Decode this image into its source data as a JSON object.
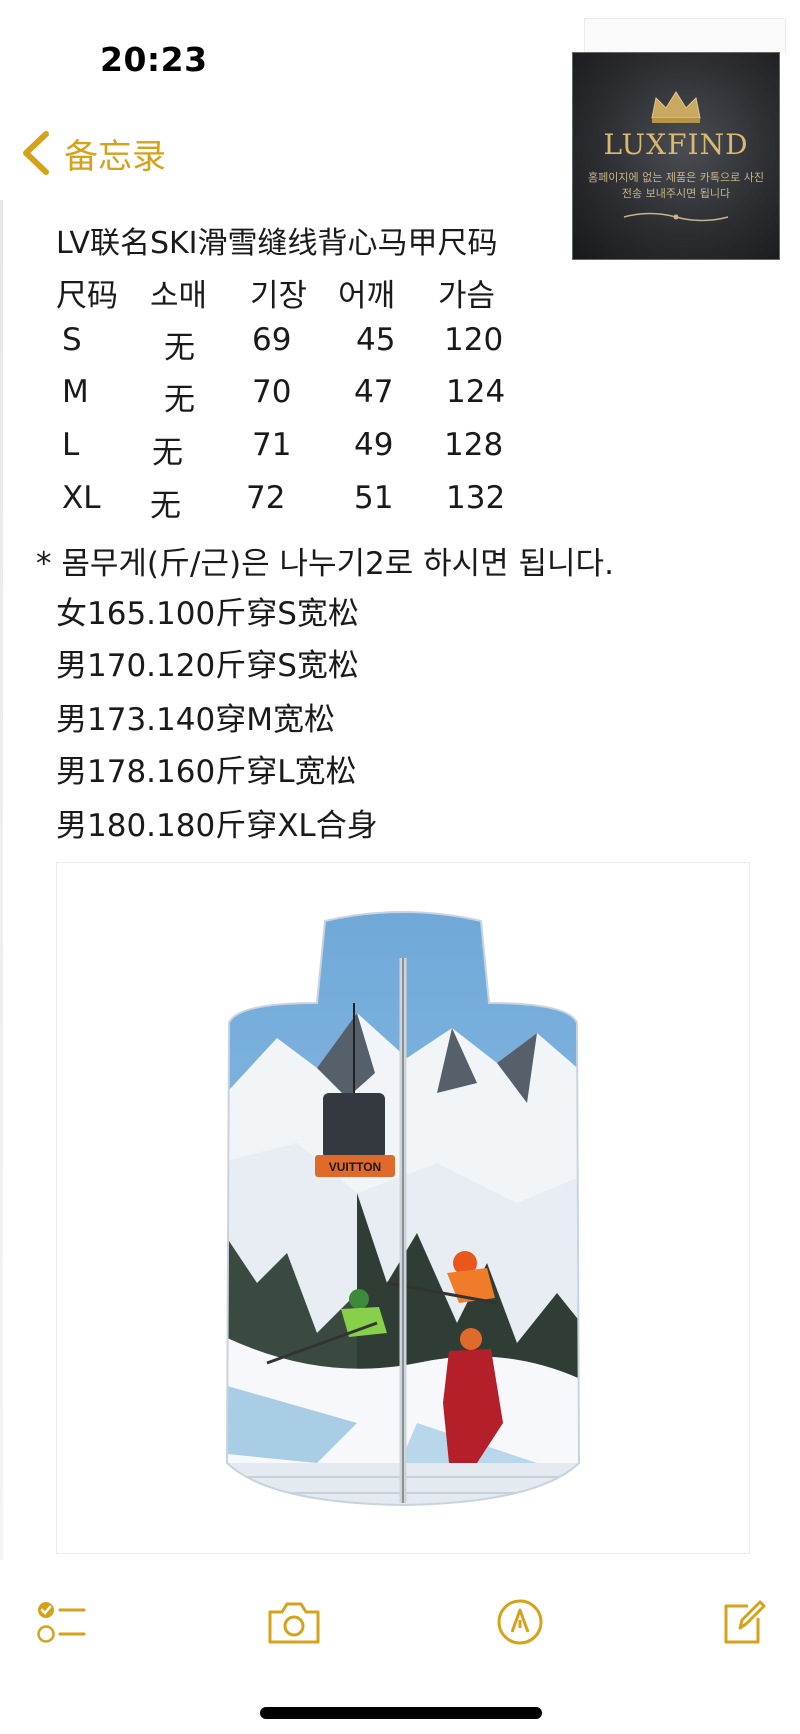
{
  "status": {
    "time": "20:23"
  },
  "nav": {
    "back_label": "备忘录"
  },
  "banner": {
    "brand": "LUXFIND",
    "tagline": "홈페이지에 없는 제품은 카톡으로 사진 전송 보내주시면 됩니다"
  },
  "note": {
    "title": "LV联名SKI滑雪缝线背心马甲尺码",
    "size_table": {
      "headers": [
        "尺码",
        "소매",
        "기장",
        "어깨",
        "가슴"
      ],
      "rows": [
        [
          "S",
          "无",
          "69",
          "45",
          "120"
        ],
        [
          "M",
          "无",
          "70",
          "47",
          "124"
        ],
        [
          "L",
          "无",
          "71",
          "49",
          "128"
        ],
        [
          "XL",
          "无",
          "72",
          "51",
          "132"
        ]
      ]
    },
    "weight_note": "* 몸무게(斤/근)은 나누기2로 하시면 됩니다.",
    "recommendations": [
      "女165.100斤穿S宽松",
      "男170.120斤穿S宽松",
      "男173.140穿M宽松",
      "男178.160斤穿L宽松",
      "男180.180斤穿XL合身"
    ],
    "product_image_text": "VUITTON"
  },
  "colors": {
    "accent": "#d6a21a"
  },
  "toolbar": {
    "icons": [
      "checklist-icon",
      "camera-icon",
      "markup-icon",
      "compose-icon"
    ]
  }
}
